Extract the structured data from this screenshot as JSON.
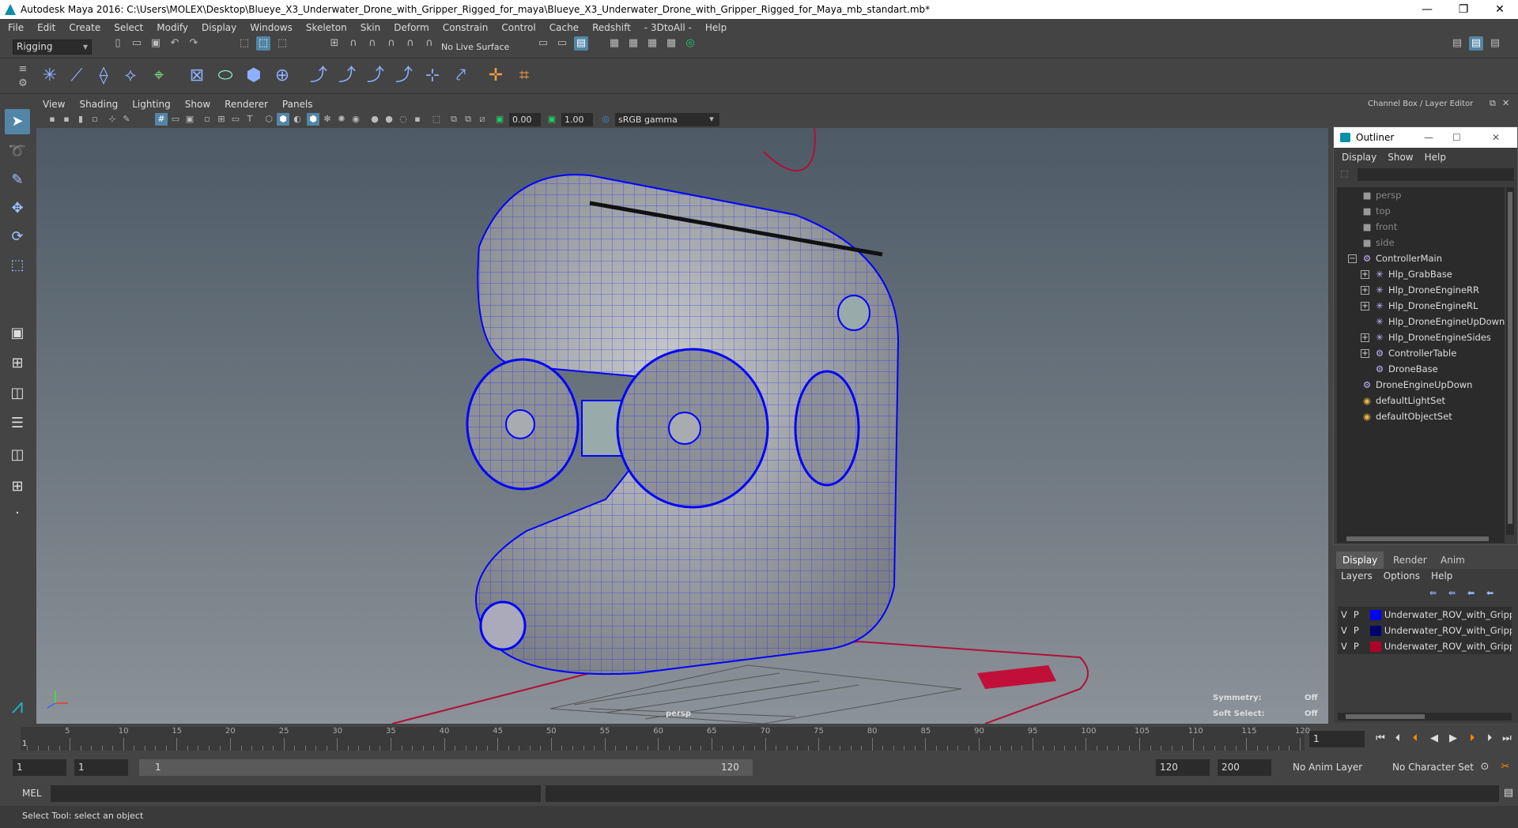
{
  "window": {
    "title": "Autodesk Maya 2016: C:\\Users\\MOLEX\\Desktop\\Blueye_X3_Underwater_Drone_with_Gripper_Rigged_for_maya\\Blueye_X3_Underwater_Drone_with_Gripper_Rigged_for_Maya_mb_standart.mb*",
    "minimize": "—",
    "maximize": "❐",
    "close": "✕"
  },
  "menubar": [
    "File",
    "Edit",
    "Create",
    "Select",
    "Modify",
    "Display",
    "Windows",
    "Skeleton",
    "Skin",
    "Deform",
    "Constrain",
    "Control",
    "Cache",
    "Redshift",
    "- 3DtoAll -",
    "Help"
  ],
  "status": {
    "mode": "Rigging",
    "live_surface": "No Live Surface"
  },
  "panel": {
    "menu": [
      "View",
      "Shading",
      "Lighting",
      "Show",
      "Renderer",
      "Panels"
    ],
    "near_value": "0.00",
    "far_value": "1.00",
    "color_space": "sRGB gamma",
    "camera_label": "persp",
    "symmetry_label": "Symmetry:",
    "symmetry_value": "Off",
    "soft_select_label": "Soft Select:",
    "soft_select_value": "Off"
  },
  "dock": {
    "title": "Channel Box / Layer Editor"
  },
  "outliner": {
    "title": "Outliner",
    "menu": [
      "Display",
      "Show",
      "Help"
    ],
    "items": [
      {
        "label": "persp",
        "icon": "camera-icon",
        "depth": 1,
        "dim": true,
        "exp": ""
      },
      {
        "label": "top",
        "icon": "camera-icon",
        "depth": 1,
        "dim": true,
        "exp": ""
      },
      {
        "label": "front",
        "icon": "camera-icon",
        "depth": 1,
        "dim": true,
        "exp": ""
      },
      {
        "label": "side",
        "icon": "camera-icon",
        "depth": 1,
        "dim": true,
        "exp": ""
      },
      {
        "label": "ControllerMain",
        "icon": "transform-icon",
        "depth": 1,
        "dim": false,
        "exp": "−"
      },
      {
        "label": "Hlp_GrabBase",
        "icon": "locator-icon",
        "depth": 2,
        "dim": false,
        "exp": "+"
      },
      {
        "label": "Hlp_DroneEngineRR",
        "icon": "locator-icon",
        "depth": 2,
        "dim": false,
        "exp": "+"
      },
      {
        "label": "Hlp_DroneEngineRL",
        "icon": "locator-icon",
        "depth": 2,
        "dim": false,
        "exp": "+"
      },
      {
        "label": "Hlp_DroneEngineUpDown",
        "icon": "locator-icon",
        "depth": 2,
        "dim": false,
        "exp": ""
      },
      {
        "label": "Hlp_DroneEngineSides",
        "icon": "locator-icon",
        "depth": 2,
        "dim": false,
        "exp": "+"
      },
      {
        "label": "ControllerTable",
        "icon": "transform-icon",
        "depth": 2,
        "dim": false,
        "exp": "+"
      },
      {
        "label": "DroneBase",
        "icon": "transform-icon",
        "depth": 2,
        "dim": false,
        "exp": ""
      },
      {
        "label": "DroneEngineUpDown",
        "icon": "transform-icon",
        "depth": 1,
        "dim": false,
        "exp": ""
      },
      {
        "label": "defaultLightSet",
        "icon": "set-icon",
        "depth": 1,
        "dim": false,
        "exp": ""
      },
      {
        "label": "defaultObjectSet",
        "icon": "set-icon",
        "depth": 1,
        "dim": false,
        "exp": ""
      }
    ]
  },
  "layers": {
    "tabs": [
      "Display",
      "Render",
      "Anim"
    ],
    "menu": [
      "Layers",
      "Options",
      "Help"
    ],
    "rows": [
      {
        "v": "V",
        "p": "P",
        "color": "#0000ff",
        "name": "Underwater_ROV_with_Gripper"
      },
      {
        "v": "V",
        "p": "P",
        "color": "#00006e",
        "name": "Underwater_ROV_with_Gripper"
      },
      {
        "v": "V",
        "p": "P",
        "color": "#b0002a",
        "name": "Underwater_ROV_with_Gripper"
      }
    ]
  },
  "timeline": {
    "ticks": [
      "5",
      "10",
      "15",
      "20",
      "25",
      "30",
      "35",
      "40",
      "45",
      "50",
      "55",
      "60",
      "65",
      "70",
      "75",
      "80",
      "85",
      "90",
      "95",
      "100",
      "105",
      "110",
      "115",
      "120"
    ],
    "current_start": "1",
    "current_frame": "1"
  },
  "range": {
    "start": "1",
    "start2": "1",
    "slider_start": "1",
    "slider_end": "120",
    "end": "120",
    "end2": "200",
    "anim_layer": "No Anim Layer",
    "char_set": "No Character Set"
  },
  "cmd": {
    "label": "MEL"
  },
  "help": {
    "text": "Select Tool: select an object"
  }
}
